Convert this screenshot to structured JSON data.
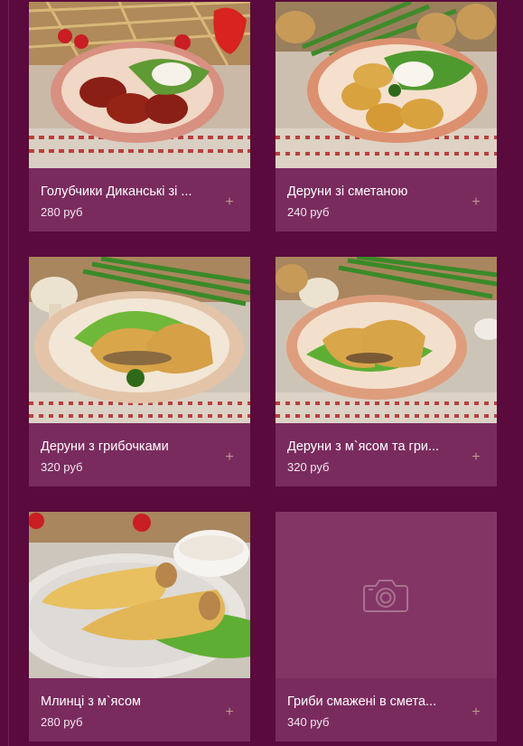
{
  "currency": "руб",
  "dishes": [
    {
      "name": "Голубчики Диканські зі ...",
      "price": "280 руб",
      "has_photo": true
    },
    {
      "name": "Деруни зі сметаною",
      "price": "240 руб",
      "has_photo": true
    },
    {
      "name": "Деруни з грибочками",
      "price": "320 руб",
      "has_photo": true
    },
    {
      "name": "Деруни з м`ясом та гри...",
      "price": "320 руб",
      "has_photo": true
    },
    {
      "name": "Млинці з м`ясом",
      "price": "280 руб",
      "has_photo": true
    },
    {
      "name": "Гриби смажені в смета...",
      "price": "340 руб",
      "has_photo": false
    }
  ],
  "add_label": "+",
  "colors": {
    "background": "#5a0a3c",
    "card": "#7a2b5e",
    "placeholder": "#833565",
    "add_icon": "#b79a8c"
  }
}
